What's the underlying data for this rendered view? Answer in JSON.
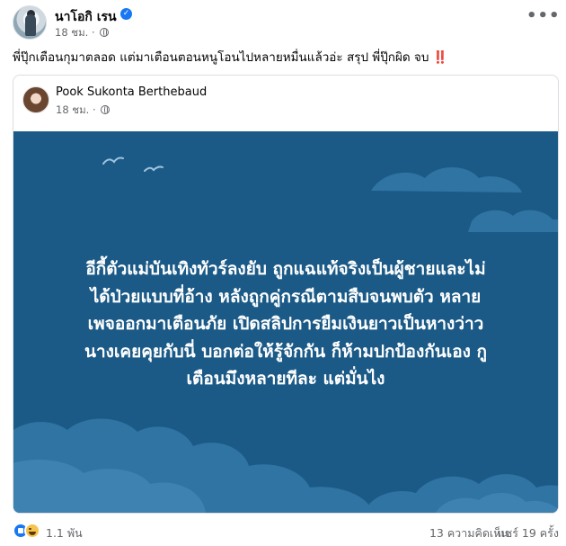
{
  "post": {
    "author": "นาโอกิ เรน",
    "time": "18 ชม.",
    "more_label": "•••",
    "caption": "พี่ปุ๊กเตือนกุมาตลอด แต่มาเตือนตอนหนูโอนไปหลายหมื่นแล้วอ่ะ สรุป พี่ปุ๊กผิด จบ",
    "caption_emoji": "‼️"
  },
  "shared": {
    "author": "Pook Sukonta Berthebaud",
    "time": "18 ชม.",
    "image_text": [
      "อีกี้ตัวแม่บันเทิงทัวร์ลงยับ ถูกแฉแท้จริงเป็นผู้ชายและไม่",
      "ได้ป่วยแบบที่อ้าง หลังถูกคู่กรณีตามสืบจนพบตัว หลาย",
      "เพจออกมาเตือนภัย เปิดสลิปการยืมเงินยาวเป็นหางว่าว",
      "นางเคยคุยกับนี่ บอกต่อให้รู้จักกัน ก็ห้ามปกป้องกันเอง กู",
      "เตือนมึงหลายทีละ แต่มั่นไง"
    ],
    "image_bg": "#1b5a87"
  },
  "footer": {
    "reactions": "1.1 พัน",
    "comments": "13 ความคิดเห็น",
    "shares": "แชร์ 19 ครั้ง"
  },
  "colors": {
    "accent": "#1877f2",
    "secondary_text": "#65676b"
  }
}
